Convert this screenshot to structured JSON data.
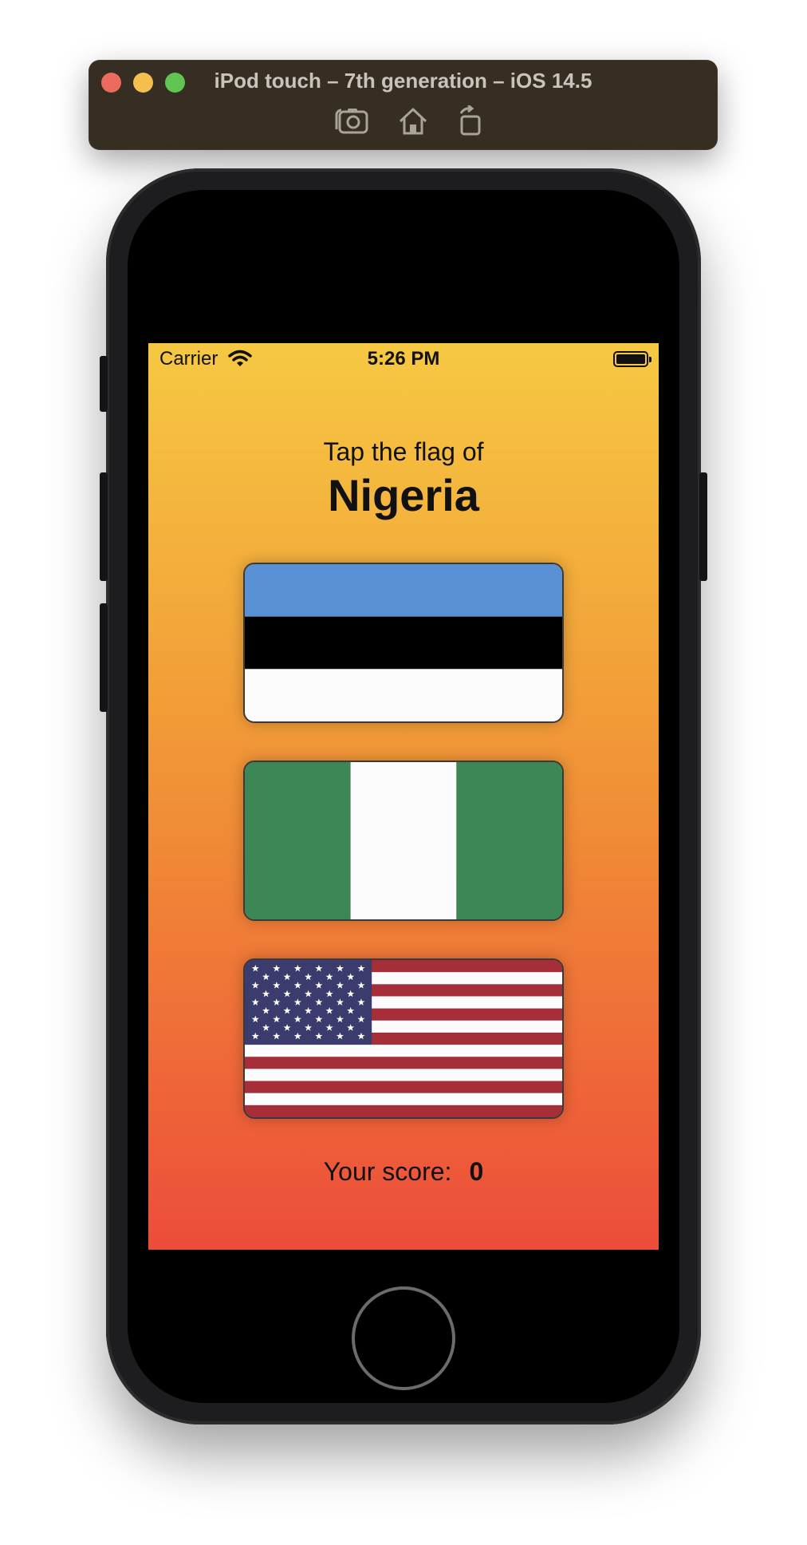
{
  "simulator": {
    "title": "iPod touch – 7th generation – iOS 14.5",
    "toolbar_icons": [
      "screenshot-icon",
      "home-icon",
      "rotate-icon"
    ]
  },
  "status_bar": {
    "carrier": "Carrier",
    "time": "5:26 PM"
  },
  "game": {
    "prompt": "Tap the flag of",
    "country": "Nigeria",
    "flags": [
      {
        "country": "Estonia"
      },
      {
        "country": "Nigeria"
      },
      {
        "country": "US"
      }
    ],
    "score_label": "Your score:",
    "score_value": "0"
  },
  "colors": {
    "gradient_top": "#f6c842",
    "gradient_bottom": "#ec4c3a",
    "estonia_blue": "#5991d4",
    "nigeria_green": "#3d8756",
    "us_red": "#a52e38",
    "us_blue": "#3c3b6e"
  }
}
